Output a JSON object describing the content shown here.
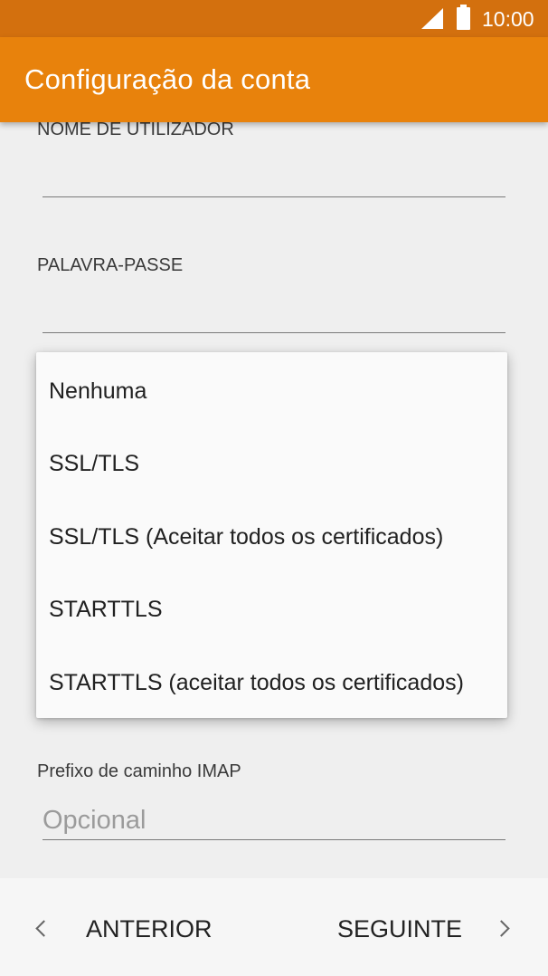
{
  "status_bar": {
    "time": "10:00",
    "icons": [
      "signal-icon",
      "battery-icon"
    ]
  },
  "header": {
    "title": "Configuração da conta"
  },
  "form": {
    "username_label": "NOME DE UTILIZADOR",
    "username_value": "",
    "password_label": "PALAVRA-PASSE",
    "password_value": "",
    "imap_prefix_label": "Prefixo de caminho IMAP",
    "imap_prefix_placeholder": "Opcional"
  },
  "security_menu": {
    "options": [
      "Nenhuma",
      "SSL/TLS",
      "SSL/TLS (Aceitar todos os certificados)",
      "STARTTLS",
      "STARTTLS (aceitar todos os certificados)"
    ]
  },
  "navigation": {
    "previous_label": "ANTERIOR",
    "next_label": "SEGUINTE",
    "icons": [
      "chevron-left-icon",
      "chevron-right-icon"
    ]
  },
  "colors": {
    "status_bar": "#d3700e",
    "app_bar": "#e8820c",
    "background": "#efefef",
    "menu_background": "#fafafa"
  }
}
